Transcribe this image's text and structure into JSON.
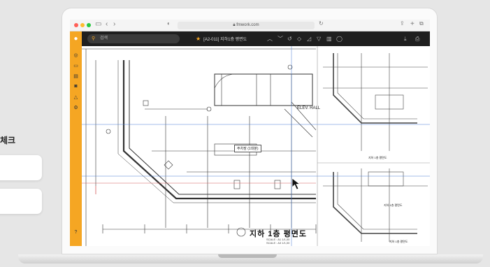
{
  "side": {
    "label": "체크"
  },
  "browser": {
    "url": "fmwork.com"
  },
  "app": {
    "search_placeholder": "검색",
    "doc_title": "[A2-011] 지하1층 평면도"
  },
  "drawing": {
    "title": "지하 1층 평면도",
    "scale_line1": "SCALE : A1 1/1,00",
    "scale_line2": "SCALE : A3 1/1,00",
    "room_label": "주차장 (1대분)",
    "elev_label": "ELEV. HALL",
    "thumb1_title": "지하 1층 평면도",
    "thumb2_title": "지하 1층 평면도",
    "thumb3_title": "지하 1층 평면도"
  },
  "colors": {
    "accent": "#f5a623",
    "toolbar": "#1f1f1f"
  },
  "icons": {
    "toolbar_right": [
      "chevron-up-icon",
      "chevron-down-icon",
      "undo-icon",
      "layers-icon",
      "measure-icon",
      "filter-icon",
      "grid-icon",
      "comment-icon"
    ],
    "sidebar": [
      "target-icon",
      "folder-icon",
      "document-icon",
      "camera-icon",
      "triangle-icon",
      "settings-icon",
      "help-icon"
    ]
  }
}
